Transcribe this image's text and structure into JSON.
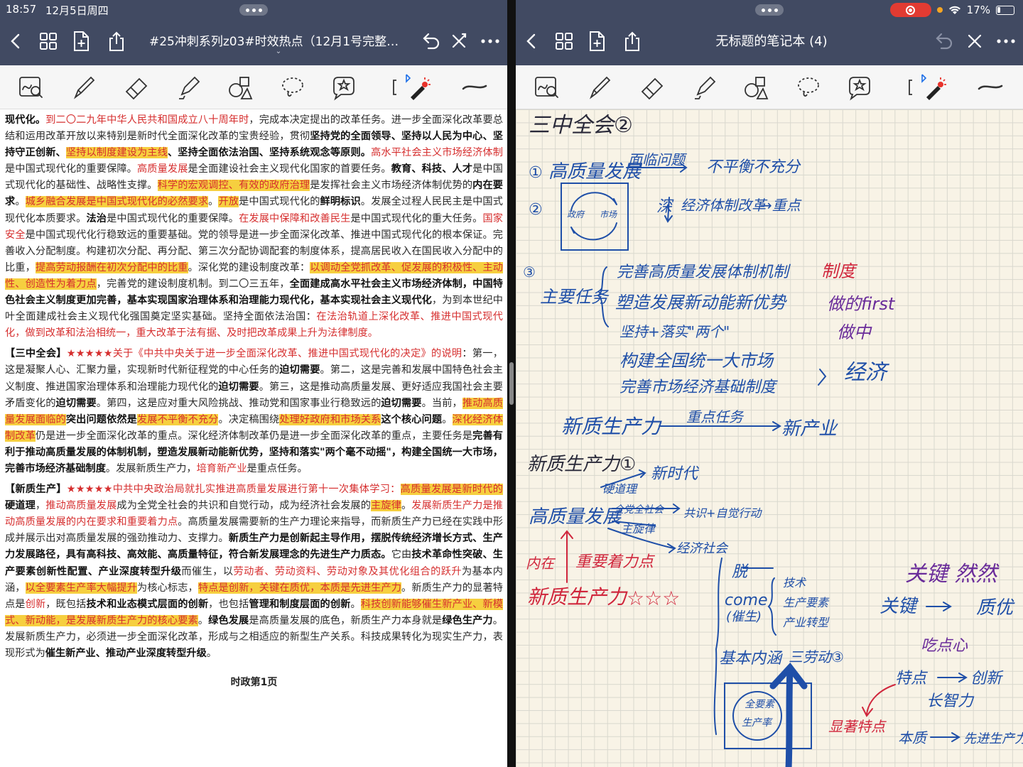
{
  "status": {
    "time": "18:57",
    "date": "12月5日周四",
    "battery": "17%"
  },
  "left": {
    "title": "#25冲刺系列z03#时效热点（12月1号完整版...",
    "footer": "时政第1页",
    "paragraphs": [
      [
        {
          "t": "现代化。",
          "s": "b"
        },
        {
          "t": "到二〇二九年中华人民共和国成立八十周年时",
          "s": "r"
        },
        {
          "t": "，完成本决定提出的改革任务。进一步全面深化改革要总结和运用改革开放以来特别是新时代全面深化改革的宝贵经验，贯彻",
          "s": "n"
        },
        {
          "t": "坚持党的全面领导、坚持以人民为中心、坚持守正创新、",
          "s": "b"
        },
        {
          "t": "坚持以制度建设为主线",
          "s": "hl"
        },
        {
          "t": "、坚持全面依法治国、坚持系统观念等原则。",
          "s": "b"
        },
        {
          "t": "高水平社会主义市场经济体制",
          "s": "r"
        },
        {
          "t": "是中国式现代化的重要保障。",
          "s": "n"
        },
        {
          "t": "高质量发展",
          "s": "r"
        },
        {
          "t": "是全面建设社会主义现代化国家的首要任务。",
          "s": "n"
        },
        {
          "t": "教育、科技、人才",
          "s": "b"
        },
        {
          "t": "是中国式现代化的基础性、战略性支撑。",
          "s": "n"
        },
        {
          "t": "科学的宏观调控、有效的政府治理",
          "s": "hl"
        },
        {
          "t": "是发挥社会主义市场经济体制优势的",
          "s": "n"
        },
        {
          "t": "内在要求",
          "s": "b"
        },
        {
          "t": "。",
          "s": "n"
        },
        {
          "t": "城乡融合发展",
          "s": "hl"
        },
        {
          "t": "是中国式现代化的必然要求",
          "s": "hl"
        },
        {
          "t": "。",
          "s": "n"
        },
        {
          "t": "开放",
          "s": "hl"
        },
        {
          "t": "是中国式现代化的",
          "s": "n"
        },
        {
          "t": "鲜明标识",
          "s": "b"
        },
        {
          "t": "。发展全过程人民民主是中国式现代化本质要求。",
          "s": "n"
        },
        {
          "t": "法治",
          "s": "b"
        },
        {
          "t": "是中国式现代化的重要保障。",
          "s": "n"
        },
        {
          "t": "在发展中保障和改善民生",
          "s": "r"
        },
        {
          "t": "是中国式现代化的重大任务。",
          "s": "n"
        },
        {
          "t": "国家安全",
          "s": "r"
        },
        {
          "t": "是中国式现代化行稳致远的重要基础。党的领导是进一步全面深化改革、推进中国式现代化的根本保证。完善收入分配制度。构建初次分配、再分配、第三次分配协调配套的制度体系，提高居民收入在国民收入分配中的比重，",
          "s": "n"
        },
        {
          "t": "提高劳动报酬在初次分配中的比重",
          "s": "hl"
        },
        {
          "t": "。深化党的建设制度改革：",
          "s": "n"
        },
        {
          "t": "以调动全党抓改革、促发展的积极性、主动性、创造性为着力点",
          "s": "hl"
        },
        {
          "t": "，完善党的建设制度机制。到二〇三五年，",
          "s": "n"
        },
        {
          "t": "全面建成高水平社会主义市场经济体制，中国特色社会主义制度更加完善，基本实现国家治理体系和治理能力现代化，基本实现社会主义现代化",
          "s": "b"
        },
        {
          "t": "，为到本世纪中叶全面建成社会主义现代化强国奠定坚实基础。坚持全面依法治国：",
          "s": "n"
        },
        {
          "t": "在法治轨道上深化改革、推进中国式现代化，做到改革和法治相统一，重大改革于法有据、及时把改革成果上升为法律制度。",
          "s": "r"
        }
      ],
      [
        {
          "t": "【三中全会】",
          "s": "b"
        },
        {
          "t": "★★★★★关于《中共中央关于进一步全面深化改革、推进中国式现代化的决定》的说明",
          "s": "r"
        },
        {
          "t": "：第一，这是凝聚人心、汇聚力量，实现新时代新征程党的中心任务的",
          "s": "n"
        },
        {
          "t": "迫切需要",
          "s": "b"
        },
        {
          "t": "。第二，这是完善和发展中国特色社会主义制度、推进国家治理体系和治理能力现代化的",
          "s": "n"
        },
        {
          "t": "迫切需要",
          "s": "b"
        },
        {
          "t": "。第三，这是推动高质量发展、更好适应我国社会主要矛盾变化的",
          "s": "n"
        },
        {
          "t": "迫切需要",
          "s": "b"
        },
        {
          "t": "。第四，这是应对重大风险挑战、推动党和国家事业行稳致远的",
          "s": "n"
        },
        {
          "t": "迫切需要",
          "s": "b"
        },
        {
          "t": "。当前，",
          "s": "n"
        },
        {
          "t": "推动高质量发展面临的",
          "s": "hl"
        },
        {
          "t": "突出问题依然是",
          "s": "b"
        },
        {
          "t": "发展不平衡不充分",
          "s": "hl"
        },
        {
          "t": "。决定稿围绕",
          "s": "n"
        },
        {
          "t": "处理好政府和市场关系",
          "s": "hl"
        },
        {
          "t": "这个核心问题",
          "s": "b"
        },
        {
          "t": "。",
          "s": "n"
        },
        {
          "t": "深化经济体制改革",
          "s": "hl"
        },
        {
          "t": "仍是进一步全面深化改革的重点。深化经济体制改革仍是进一步全面深化改革的重点，主要任务是",
          "s": "n"
        },
        {
          "t": "完善有利于推动高质量发展的体制机制，塑造发展新动能新优势，坚持和落实\"两个毫不动摇\"，构建全国统一大市场，完善市场经济基础制度",
          "s": "b"
        },
        {
          "t": "。发展新质生产力，",
          "s": "n"
        },
        {
          "t": "培育新产业",
          "s": "r"
        },
        {
          "t": "是重点任务。",
          "s": "n"
        }
      ],
      [
        {
          "t": "【新质生产】",
          "s": "b"
        },
        {
          "t": "★★★★★中共中央政治局就扎实推进高质量发展进行第十一次集体学习：",
          "s": "r"
        },
        {
          "t": "高质量发展是新时代的",
          "s": "hl"
        },
        {
          "t": "硬道理",
          "s": "b"
        },
        {
          "t": "，",
          "s": "n"
        },
        {
          "t": "推动高质量发展",
          "s": "r"
        },
        {
          "t": "成为全党全社会的共识和自觉行动，成为经济社会发展的",
          "s": "n"
        },
        {
          "t": "主旋律",
          "s": "hl"
        },
        {
          "t": "。",
          "s": "n"
        },
        {
          "t": "发展新质生产力",
          "s": "r"
        },
        {
          "t": "是推动高质量发展的内在要求和重要着力点",
          "s": "r"
        },
        {
          "t": "。高质量发展需要新的生产力理论来指导，而新质生产力已经在实践中形成并展示出对高质量发展的强劲推动力、支撑力。",
          "s": "n"
        },
        {
          "t": "新质生产力是创新起主导作用，摆脱传统经济增长方式、生产力发展路径，具有高科技、高效能、高质量特征，符合新发展理念的先进生产力质态。",
          "s": "b"
        },
        {
          "t": "它由",
          "s": "n"
        },
        {
          "t": "技术革命性突破、生产要素创新性配置、产业深度转型升级",
          "s": "b"
        },
        {
          "t": "而催生，以",
          "s": "n"
        },
        {
          "t": "劳动者、劳动资料、劳动对象及其优化组合的跃升",
          "s": "r"
        },
        {
          "t": "为基本内涵，",
          "s": "n"
        },
        {
          "t": "以全要素生产率大幅提升",
          "s": "hl"
        },
        {
          "t": "为核心标志，",
          "s": "n"
        },
        {
          "t": "特点是创新，关键在质优，本质是先进生产力",
          "s": "hl"
        },
        {
          "t": "。新质生产力的显著特点是",
          "s": "n"
        },
        {
          "t": "创新",
          "s": "r"
        },
        {
          "t": "，既包括",
          "s": "n"
        },
        {
          "t": "技术和业态模式层面的创新",
          "s": "b"
        },
        {
          "t": "，也包括",
          "s": "n"
        },
        {
          "t": "管理和制度层面的创新",
          "s": "b"
        },
        {
          "t": "。",
          "s": "n"
        },
        {
          "t": "科技创新",
          "s": "hl"
        },
        {
          "t": "能够催生新产业、新模式、新动能，是发展新质生产力的核心要素",
          "s": "hl"
        },
        {
          "t": "。",
          "s": "n"
        },
        {
          "t": "绿色发展",
          "s": "b"
        },
        {
          "t": "是高质量发展的底色，新质生产力本身就是",
          "s": "n"
        },
        {
          "t": "绿色生产力",
          "s": "b"
        },
        {
          "t": "。发展新质生产力，必须进一步全面深化改革，形成与之相适应的新型生产关系。科技成果转化为现实生产力，表现形式为",
          "s": "n"
        },
        {
          "t": "催生新产业、推动产业深度转型升级",
          "s": "b"
        },
        {
          "t": "。",
          "s": "n"
        }
      ]
    ]
  },
  "right": {
    "title": "无标题的笔记本 (4)",
    "notes": {
      "heading": "三中全会②",
      "n1": "①",
      "gaozhiliang": "高质量发展",
      "mianlin": "面临问题",
      "buping": "不平衡不充分",
      "n2": "②",
      "zhengfu": "政府",
      "shichang": "市场",
      "shen": "深",
      "jingji_gaige": "经济体制改革",
      "zhongdian": "→重点",
      "n3": "③",
      "zhuyao": "主要任务",
      "task1": "完善高质量发展体制机制",
      "task2": "塑造发展新动能新优势",
      "task3": "坚持+落实\"两个\"",
      "task4": "构建全国统一大市场",
      "task5": "完善市场经济基础制度",
      "zhidu": "制度",
      "first": "做的first",
      "zuozhong": "做中",
      "jingji": "经济",
      "xinzhi1": "新质生产力",
      "zhongdian_renwu": "重点任务",
      "xinchanye": "新产业",
      "xinzhi_heading": "新质生产力①",
      "yingdaoli": "硬道理",
      "xinshidai": "新时代",
      "gaozhiliang2": "高质量发展",
      "quandang": "全党全社会",
      "gongshi": "共识+自觉行动",
      "zhuxuanlv": "主旋律",
      "jingji_shehui": "经济社会",
      "neizai": "内在",
      "zhongyao": "重要着力点",
      "xinzhi2": "新质生产力",
      "stars": "☆☆☆",
      "tuo": "脱",
      "come": "come",
      "cuisheng": "(催生)",
      "jishu": "技术",
      "shengchan_yaosu": "生产要素",
      "chanye": "产业转型",
      "jiben": "基本内涵",
      "jiben_suffix": "三劳动③",
      "quanyaosu": "全要素",
      "shengchanlv": "生产率",
      "guanjian_title": "关键 然然",
      "guanjian": "关键",
      "zhiyou": "质优",
      "chidian": "吃点心",
      "tedian": "特点",
      "chuangxin": "创新",
      "zhangzhi": "长智力",
      "xianzhu": "显著特点",
      "benzhi": "本质",
      "xianjin": "先进生产力"
    }
  },
  "colors": {
    "navbar": "#414a62",
    "ink_blue": "#1f4fa8",
    "ink_red": "#d0263c",
    "ink_purple": "#6a2c9a",
    "highlight": "#f6cf3f"
  }
}
